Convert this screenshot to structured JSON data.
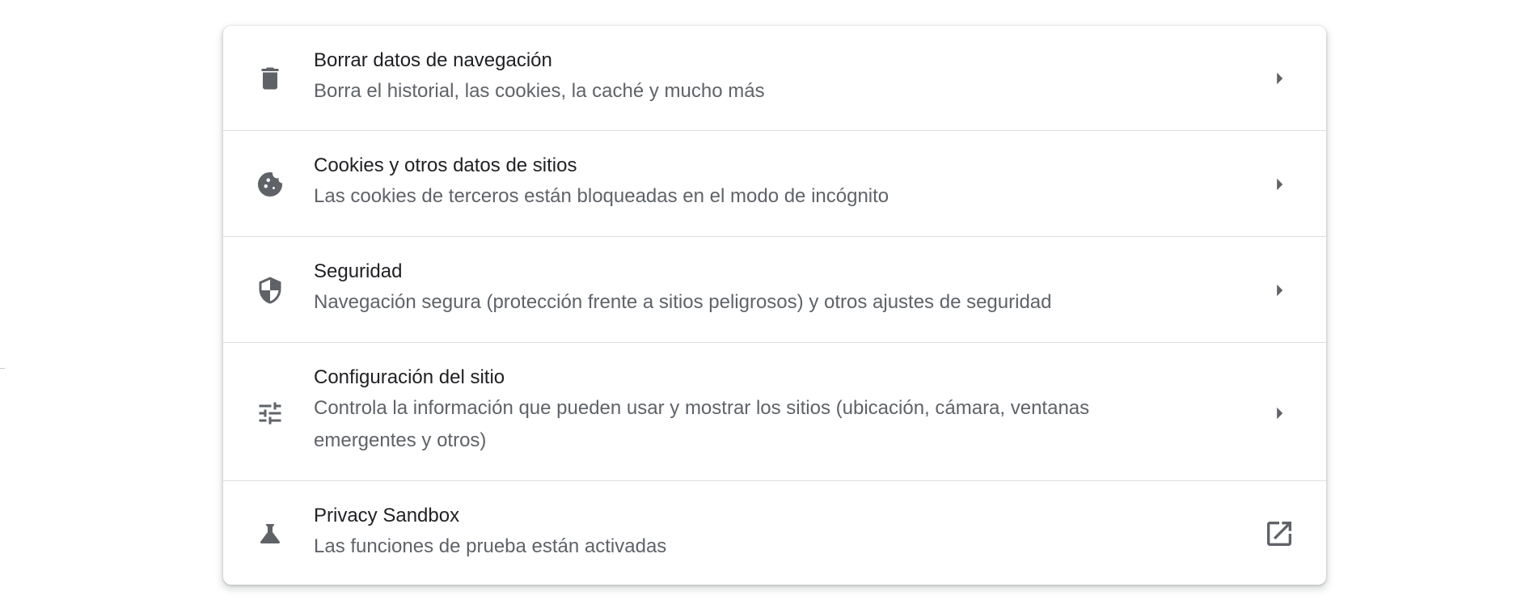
{
  "settings_list": {
    "items": [
      {
        "title": "Borrar datos de navegación",
        "subtitle": "Borra el historial, las cookies, la caché y mucho más",
        "icon": "trash-icon",
        "action_icon": "chevron-right-icon"
      },
      {
        "title": "Cookies y otros datos de sitios",
        "subtitle": "Las cookies de terceros están bloqueadas en el modo de incógnito",
        "icon": "cookie-icon",
        "action_icon": "chevron-right-icon"
      },
      {
        "title": "Seguridad",
        "subtitle": "Navegación segura (protección frente a sitios peligrosos) y otros ajustes de seguridad",
        "icon": "shield-icon",
        "action_icon": "chevron-right-icon"
      },
      {
        "title": "Configuración del sitio",
        "subtitle": "Controla la información que pueden usar y mostrar los sitios (ubicación, cámara, ventanas emergentes y otros)",
        "icon": "tune-sliders-icon",
        "action_icon": "chevron-right-icon"
      },
      {
        "title": "Privacy Sandbox",
        "subtitle": "Las funciones de prueba están activadas",
        "icon": "flask-icon",
        "action_icon": "open-in-new-icon"
      }
    ]
  },
  "colors": {
    "icon": "#5f6368",
    "title": "#202124",
    "subtitle": "#5f6368",
    "divider": "#dedede",
    "background": "#ffffff"
  }
}
